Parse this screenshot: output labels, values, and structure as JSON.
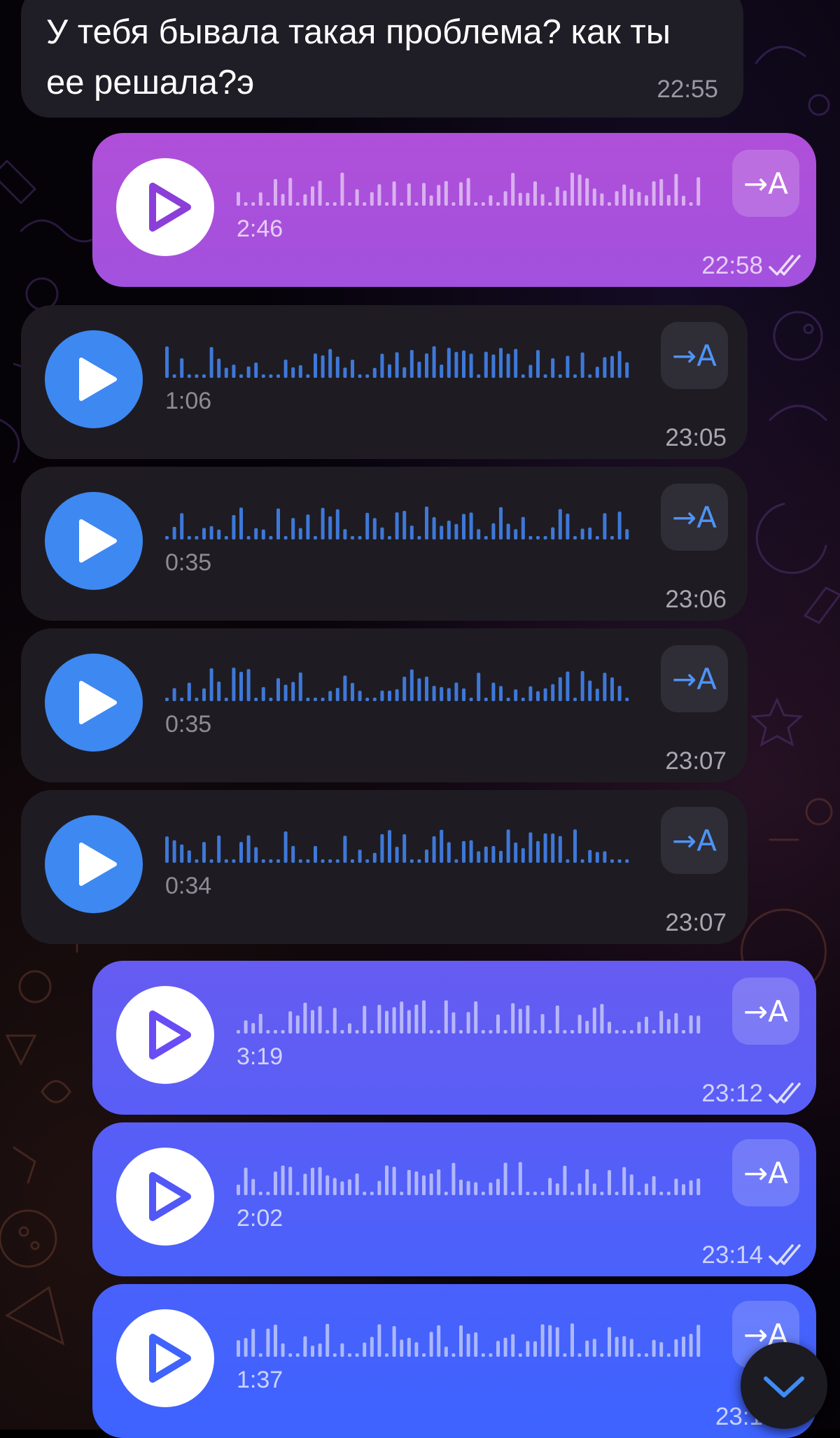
{
  "colors": {
    "incoming_bubble": "#1f1d25",
    "incoming_accent": "#3e88f2",
    "outgoing_gradient_top": "#b04fd9",
    "outgoing_gradient_bottom": "#3d63ff"
  },
  "text_message": {
    "text": "У тебя бывала такая проблема? как ты ее решала?э",
    "time": "22:55"
  },
  "voice_messages": [
    {
      "direction": "out",
      "duration": "2:46",
      "time": "22:58",
      "transcribe_label": "→A",
      "read": true
    },
    {
      "direction": "in",
      "duration": "1:06",
      "time": "23:05",
      "transcribe_label": "→A"
    },
    {
      "direction": "in",
      "duration": "0:35",
      "time": "23:06",
      "transcribe_label": "→A"
    },
    {
      "direction": "in",
      "duration": "0:35",
      "time": "23:07",
      "transcribe_label": "→A"
    },
    {
      "direction": "in",
      "duration": "0:34",
      "time": "23:07",
      "transcribe_label": "→A"
    },
    {
      "direction": "out",
      "duration": "3:19",
      "time": "23:12",
      "transcribe_label": "→A",
      "read": true
    },
    {
      "direction": "out",
      "duration": "2:02",
      "time": "23:14",
      "transcribe_label": "→A",
      "read": true
    },
    {
      "direction": "out",
      "duration": "1:37",
      "time": "23:1",
      "transcribe_label": "→A",
      "read": true
    }
  ],
  "icons": {
    "play": "play-icon",
    "transcribe": "transcribe-icon",
    "read_receipt": "double-check-icon",
    "scroll_down": "chevron-down-icon"
  }
}
